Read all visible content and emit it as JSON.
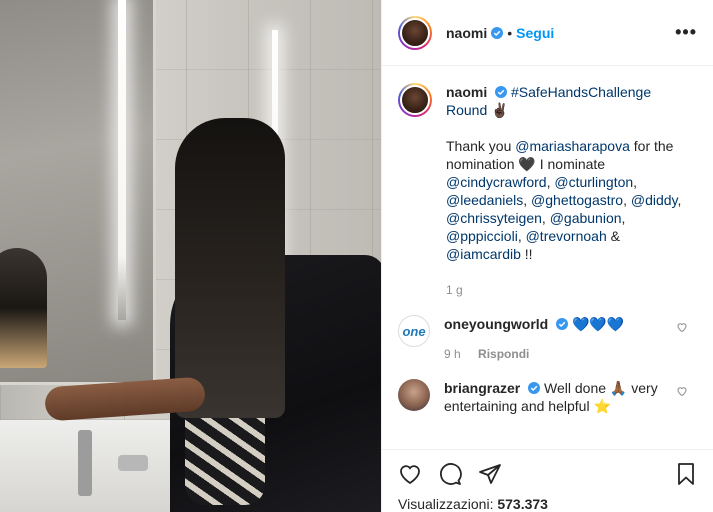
{
  "post": {
    "username": "naomi",
    "separator": "•",
    "follow_label": "Segui",
    "more_icon": "•••",
    "caption": {
      "username": "naomi",
      "first_line": "#SafeHandsChallenge Round",
      "first_line_emoji": "✌🏿",
      "thanks_prefix": "Thank you ",
      "thanks_mention": "@mariasharapova",
      "thanks_suffix": " for the nomination ",
      "heart_emoji": "🖤",
      "nominate_text": " I nominate",
      "mentions": [
        "@cindycrawford",
        "@cturlington",
        "@leedaniels",
        "@ghettogastro",
        "@diddy",
        "@chrissyteigen",
        "@gabunion",
        "@pppiccioli",
        "@trevornoah",
        "@iamcardib"
      ],
      "ending": " !!",
      "time": "1 g"
    },
    "comments": [
      {
        "avatar_text": "one",
        "username": "oneyoungworld",
        "text": " 💙💙💙",
        "time": "9 h",
        "reply_label": "Rispondi"
      },
      {
        "username": "briangrazer",
        "text": " Well done 🙏🏾 very entertaining and helpful ⭐"
      }
    ],
    "views_label": "Visualizzazioni: ",
    "views_count": "573.373"
  },
  "colors": {
    "accent": "#0095f6",
    "verified": "#3897f0",
    "text": "#262626",
    "muted": "#8e8e8e"
  }
}
